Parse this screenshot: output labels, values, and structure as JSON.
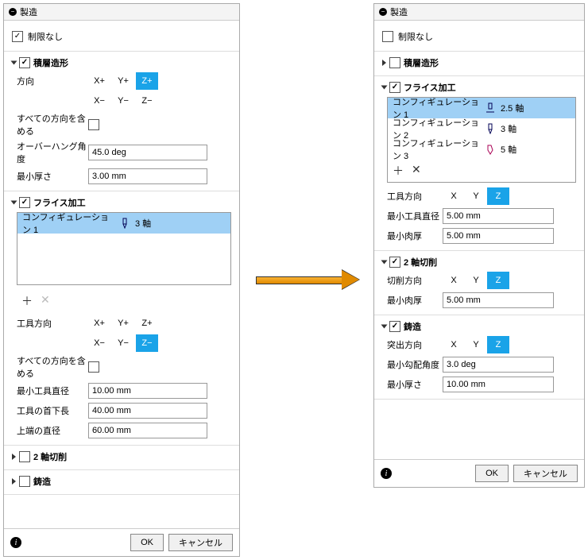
{
  "left": {
    "title": "製造",
    "no_limit": "制限なし",
    "additive": {
      "title": "積層造形",
      "direction_label": "方向",
      "axes1": [
        "X+",
        "Y+",
        "Z+"
      ],
      "axes2": [
        "X−",
        "Y−",
        "Z−"
      ],
      "selected_axis": "Z+",
      "all_dirs_label": "すべての方向を含める",
      "overhang_label": "オーバーハング角度",
      "overhang_value": "45.0 deg",
      "min_thick_label": "最小厚さ",
      "min_thick_value": "3.00 mm"
    },
    "milling": {
      "title": "フライス加工",
      "config1_label": "コンフィギュレーション 1",
      "config1_axis": "3 軸",
      "tool_dir_label": "工具方向",
      "axes1": [
        "X+",
        "Y+",
        "Z+"
      ],
      "axes2": [
        "X−",
        "Y−",
        "Z−"
      ],
      "selected_axis": "Z−",
      "all_dirs_label": "すべての方向を含める",
      "min_tool_dia_label": "最小工具直径",
      "min_tool_dia_value": "10.00 mm",
      "tool_neck_label": "工具の首下長",
      "tool_neck_value": "40.00 mm",
      "top_dia_label": "上端の直径",
      "top_dia_value": "60.00 mm"
    },
    "two_axis_title": "2 軸切削",
    "casting_title": "鋳造",
    "ok": "OK",
    "cancel": "キャンセル"
  },
  "right": {
    "title": "製造",
    "no_limit": "制限なし",
    "additive_title": "積層造形",
    "milling": {
      "title": "フライス加工",
      "config1_label": "コンフィギュレーション 1",
      "config1_axis": "2.5 軸",
      "config2_label": "コンフィギュレーション 2",
      "config2_axis": "3 軸",
      "config3_label": "コンフィギュレーション 3",
      "config3_axis": "5 軸",
      "tool_dir_label": "工具方向",
      "axis_x": "X",
      "axis_y": "Y",
      "axis_z": "Z",
      "min_tool_dia_label": "最小工具直径",
      "min_tool_dia_value": "5.00 mm",
      "min_wall_label": "最小肉厚",
      "min_wall_value": "5.00 mm"
    },
    "two_axis": {
      "title": "2 軸切削",
      "cut_dir_label": "切削方向",
      "axis_x": "X",
      "axis_y": "Y",
      "axis_z": "Z",
      "min_wall_label": "最小肉厚",
      "min_wall_value": "5.00 mm"
    },
    "casting": {
      "title": "鋳造",
      "eject_dir_label": "突出方向",
      "axis_x": "X",
      "axis_y": "Y",
      "axis_z": "Z",
      "min_draft_label": "最小勾配角度",
      "min_draft_value": "3.0 deg",
      "min_thick_label": "最小厚さ",
      "min_thick_value": "10.00 mm"
    },
    "ok": "OK",
    "cancel": "キャンセル"
  }
}
